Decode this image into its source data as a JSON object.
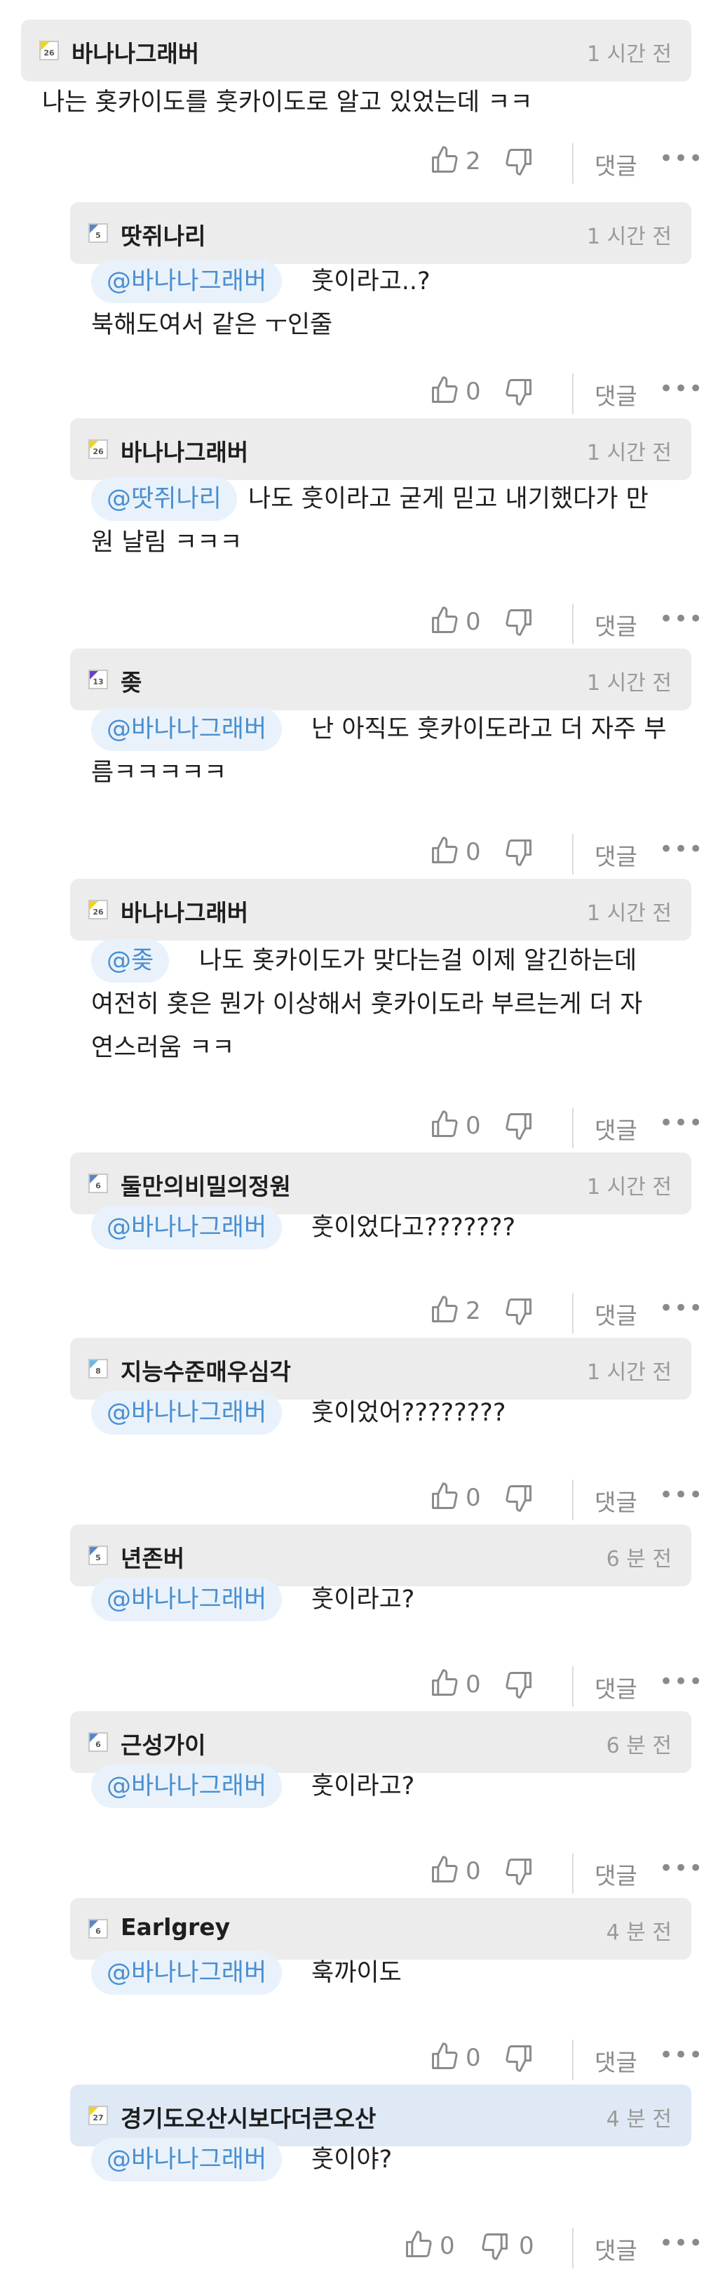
{
  "comments": [
    {
      "user": "바나나그래버",
      "level": "26",
      "time": "1 시간 전",
      "lines": [
        "나는 홋카이도를 훗카이도로 알고 있었는데 ㅋㅋ"
      ],
      "likes": "2",
      "mention": "",
      "dislikes": "",
      "reply": "댓글"
    },
    {
      "user": "땃쥐나리",
      "level": "5",
      "time": "1 시간 전",
      "mention": "@바나나그래버",
      "lines": [
        "훗이라고..?",
        "북해도여서 같은 ㅜ인줄"
      ],
      "likes": "0",
      "dislikes": "",
      "reply": "댓글"
    },
    {
      "user": "바나나그래버",
      "level": "26",
      "time": "1 시간 전",
      "mention": "@땃쥐나리",
      "lines": [
        "나도 훗이라고 굳게 믿고 내기했다가 만",
        "원 날림 ㅋㅋㅋ"
      ],
      "likes": "0",
      "dislikes": "",
      "reply": "댓글"
    },
    {
      "user": "좆",
      "level": "13",
      "time": "1 시간 전",
      "mention": "@바나나그래버",
      "lines": [
        "난 아직도 훗카이도라고 더 자주 부",
        "름ㅋㅋㅋㅋㅋ"
      ],
      "likes": "0",
      "dislikes": "",
      "reply": "댓글"
    },
    {
      "user": "바나나그래버",
      "level": "26",
      "time": "1 시간 전",
      "mention": "@좆",
      "lines": [
        "나도 홋카이도가 맞다는걸 이제 알긴하는데",
        "여전히 홋은 뭔가 이상해서 훗카이도라 부르는게 더 자",
        "연스러움 ㅋㅋ"
      ],
      "likes": "0",
      "dislikes": "",
      "reply": "댓글"
    },
    {
      "user": "둘만의비밀의정원",
      "level": "6",
      "time": "1 시간 전",
      "mention": "@바나나그래버",
      "lines": [
        "훗이었다고???????"
      ],
      "likes": "2",
      "dislikes": "",
      "reply": "댓글"
    },
    {
      "user": "지능수준매우심각",
      "level": "8",
      "time": "1 시간 전",
      "mention": "@바나나그래버",
      "lines": [
        "훗이었어????????"
      ],
      "likes": "0",
      "dislikes": "",
      "reply": "댓글"
    },
    {
      "user": "년존버",
      "level": "5",
      "time": "6 분 전",
      "mention": "@바나나그래버",
      "lines": [
        "훗이라고?"
      ],
      "likes": "0",
      "dislikes": "",
      "reply": "댓글"
    },
    {
      "user": "근성가이",
      "level": "6",
      "time": "6 분 전",
      "mention": "@바나나그래버",
      "lines": [
        "훗이라고?"
      ],
      "likes": "0",
      "dislikes": "",
      "reply": "댓글"
    },
    {
      "user": "Earlgrey",
      "level": "6",
      "time": "4 분 전",
      "mention": "@바나나그래버",
      "lines": [
        "훅까이도"
      ],
      "likes": "0",
      "dislikes": "",
      "reply": "댓글"
    },
    {
      "user": "경기도오산시보다더큰오산",
      "level": "27",
      "time": "4 분 전",
      "mention": "@바나나그래버",
      "lines": [
        "훗이야?"
      ],
      "likes": "0",
      "dislikes": "0",
      "reply": "댓글",
      "highlighted": true
    }
  ],
  "colors": {
    "header_bg": "#ececec",
    "header_highlight": "#dfe9f6",
    "mention_text": "#4a8fd0",
    "mention_bg": "#e9f2fb",
    "level_26": "#f3d21e",
    "level_13": "#6a3fc4",
    "level_5": "#5b86c5",
    "level_6": "#5b86c5",
    "level_8": "#6fb7e6",
    "level_27": "#f3d21e"
  },
  "icons": {
    "like": "thumbs-up-icon",
    "dislike": "thumbs-down-icon",
    "more": "more-dots-icon"
  }
}
